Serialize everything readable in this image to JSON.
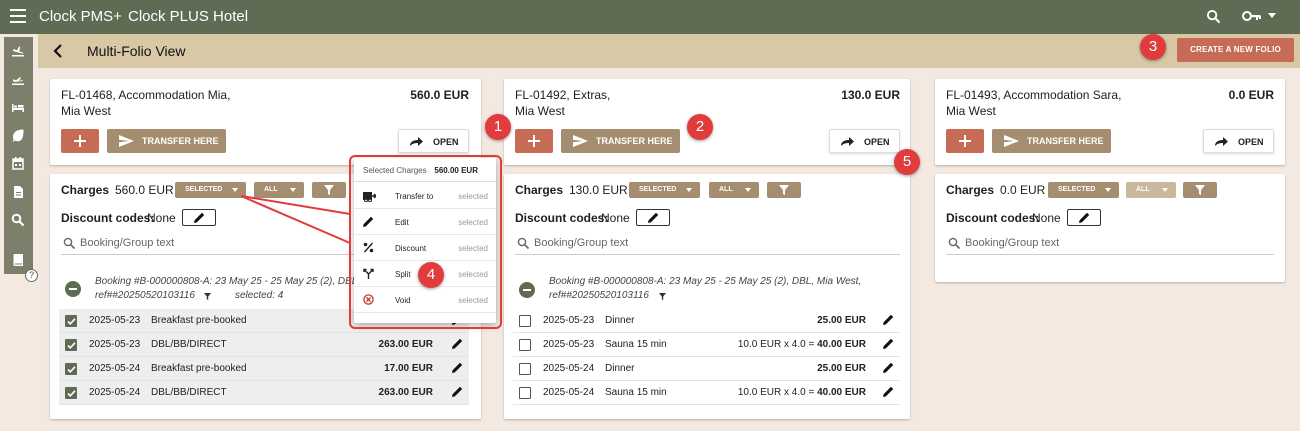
{
  "app": {
    "name": "Clock PMS+",
    "hotel": "Clock PLUS Hotel"
  },
  "header": {
    "title": "Multi-Folio View",
    "create_folio_label": "CREATE A NEW FOLIO"
  },
  "sidebar": {
    "icons": [
      "arrivals-icon",
      "departures-icon",
      "bed-icon",
      "leaf-icon",
      "calendar-icon",
      "document-icon",
      "search-icon",
      "book-icon"
    ],
    "help_label": "?"
  },
  "labels": {
    "transfer_here": "TRANSFER HERE",
    "open": "OPEN",
    "charges": "Charges",
    "discount_codes": "Discount codes:",
    "search_placeholder": "Booking/Group text",
    "selected": "SELECTED",
    "all": "ALL"
  },
  "folios": [
    {
      "name_line1": "FL-01468, Accommodation Mia,",
      "name_line2": "Mia West",
      "amount": "560.0 EUR",
      "charges_amount": "560.0 EUR",
      "discount": "None",
      "booking_line1": "Booking #B-000000808-A: 23 May 25 - 25 May 25 (2), DBL, Mia West,",
      "booking_line2": "ref##20250520103116",
      "selected_count": "selected: 4",
      "rows": [
        {
          "date": "2025-05-23",
          "desc": "Breakfast pre-booked",
          "amount": "",
          "checked": true
        },
        {
          "date": "2025-05-23",
          "desc": "DBL/BB/DIRECT",
          "amount": "263.00 EUR",
          "checked": true
        },
        {
          "date": "2025-05-24",
          "desc": "Breakfast pre-booked",
          "amount": "17.00 EUR",
          "checked": true
        },
        {
          "date": "2025-05-24",
          "desc": "DBL/BB/DIRECT",
          "amount": "263.00 EUR",
          "checked": true
        }
      ]
    },
    {
      "name_line1": "FL-01492, Extras,",
      "name_line2": "Mia West",
      "amount": "130.0 EUR",
      "charges_amount": "130.0 EUR",
      "discount": "None",
      "booking_line1": "Booking #B-000000808-A: 23 May 25 - 25 May 25 (2), DBL, Mia West,",
      "booking_line2": "ref##20250520103116",
      "rows": [
        {
          "date": "2025-05-23",
          "desc": "Dinner",
          "prefix": "",
          "amount": "25.00 EUR",
          "checked": false
        },
        {
          "date": "2025-05-23",
          "desc": "Sauna 15 min",
          "prefix": "10.0 EUR x 4.0 = ",
          "amount": "40.00 EUR",
          "checked": false
        },
        {
          "date": "2025-05-24",
          "desc": "Dinner",
          "prefix": "",
          "amount": "25.00 EUR",
          "checked": false
        },
        {
          "date": "2025-05-24",
          "desc": "Sauna 15 min",
          "prefix": "10.0 EUR x 4.0 = ",
          "amount": "40.00 EUR",
          "checked": false
        }
      ]
    },
    {
      "name_line1": "FL-01493, Accommodation Sara,",
      "name_line2": "Mia West",
      "amount": "0.0 EUR",
      "charges_amount": "0.0 EUR",
      "discount": "None"
    }
  ],
  "menu": {
    "header_label": "Selected Charges",
    "header_amount": "560.00 EUR",
    "items": [
      {
        "label": "Transfer to",
        "state": "selected"
      },
      {
        "label": "Edit",
        "state": "selected"
      },
      {
        "label": "Discount",
        "state": "selected"
      },
      {
        "label": "Split",
        "state": "selected"
      },
      {
        "label": "Void",
        "state": "selected"
      }
    ]
  },
  "callouts": [
    "1",
    "2",
    "3",
    "4",
    "5"
  ],
  "colors": {
    "topbar": "#5f6b53",
    "header": "#d8c8a6",
    "accent_red": "#c66b55",
    "chip_brown": "#a58d6f",
    "callout_red": "#e03c3c",
    "background": "#f3e9e1"
  }
}
